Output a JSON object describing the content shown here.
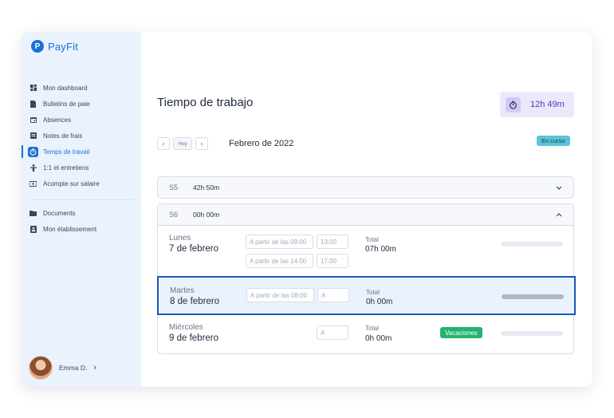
{
  "app": {
    "name": "PayFit",
    "logo_letter": "P"
  },
  "sidebar": {
    "items": [
      {
        "label": "Mon dashboard",
        "icon": "dashboard-icon"
      },
      {
        "label": "Bulletins de paie",
        "icon": "document-icon"
      },
      {
        "label": "Absences",
        "icon": "calendar-icon"
      },
      {
        "label": "Notes de frais",
        "icon": "receipt-icon"
      },
      {
        "label": "Temps de travail",
        "icon": "stopwatch-icon",
        "active": true
      },
      {
        "label": "1:1 et entretiens",
        "icon": "person-icon"
      },
      {
        "label": "Acompte sur salaire",
        "icon": "money-icon"
      }
    ],
    "secondary_items": [
      {
        "label": "Documents",
        "icon": "folder-icon"
      },
      {
        "label": "Mon établissement",
        "icon": "building-icon"
      }
    ],
    "user": {
      "name": "Emma D."
    }
  },
  "main": {
    "title": "Tiempo de trabajo",
    "timer": {
      "value": "12h 49m"
    },
    "calendar_nav": {
      "today_label": "Hoy",
      "prev": "‹",
      "next": "›"
    },
    "month": "Febrero de 2022",
    "status": "En curso",
    "weeks": [
      {
        "label": "S5",
        "total": "42h 50m",
        "chevron": "⌄"
      },
      {
        "label": "S6",
        "total": "00h 00m",
        "chevron": "⌃"
      }
    ],
    "days": [
      {
        "name": "Lunes",
        "date": "7 de febrero",
        "from_placeholder_1": "A partir de las 09:00",
        "to_placeholder_1": "13:00",
        "from_placeholder_2": "A partir de las 14:00",
        "to_placeholder_2": "17:00",
        "total_label": "Total",
        "total": "07h 00m"
      },
      {
        "name": "Martes",
        "date": "8 de febrero",
        "from_placeholder": "A partir de las 08:00",
        "to_placeholder": "A",
        "total_label": "Total",
        "total": "0h 00m"
      },
      {
        "name": "Miércoles",
        "date": "9 de febrero",
        "to_placeholder": "A",
        "total_label": "Total",
        "total": "0h 00m",
        "badge": "Vacaciones"
      }
    ]
  },
  "colors": {
    "accent": "#1c6fd8",
    "timer_bg": "#ece8fb",
    "status": "#5cc4d6",
    "vacation": "#21b36f"
  }
}
